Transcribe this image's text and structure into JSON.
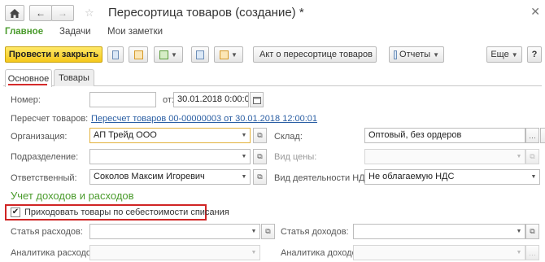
{
  "nav": {
    "home_icon": "home-icon",
    "back_icon": "arrow-left-icon",
    "forward_icon": "arrow-right-icon",
    "favorite_icon": "star-icon",
    "close_icon": "close-icon"
  },
  "window": {
    "title": "Пересортица товаров (создание) *"
  },
  "sections": [
    {
      "label": "Главное"
    },
    {
      "label": "Задачи"
    },
    {
      "label": "Мои заметки"
    }
  ],
  "toolbar": {
    "post_close": "Провести и закрыть",
    "act": "Акт о пересортице товаров",
    "reports": "Отчеты",
    "more": "Еще",
    "help": "?"
  },
  "tabs": [
    {
      "label": "Основное"
    },
    {
      "label": "Товары"
    }
  ],
  "form": {
    "number_label": "Номер:",
    "number_value": "",
    "date_prefix": "от:",
    "date_value": "30.01.2018  0:00:00",
    "regrade_label": "Пересчет товаров:",
    "regrade_link": "Пересчет товаров 00-00000003 от 30.01.2018 12:00:01",
    "org_label": "Организация:",
    "org_value": "АП Трейд ООО",
    "warehouse_label": "Склад:",
    "warehouse_value": "Оптовый, без ордеров",
    "division_label": "Подразделение:",
    "division_value": "",
    "price_type_label": "Вид цены:",
    "price_type_value": "",
    "responsible_label": "Ответственный:",
    "responsible_value": "Соколов Максим Игоревич",
    "vat_label": "Вид деятельности НДС:",
    "vat_value": "Не облагаемую НДС",
    "section_title": "Учет доходов и расходов",
    "checkbox_label": "Приходовать товары по себестоимости списания",
    "checkbox_checked": "✔",
    "expense_item_label": "Статья расходов:",
    "expense_item_value": "",
    "income_item_label": "Статья доходов:",
    "income_item_value": "",
    "expense_analytics_label": "Аналитика расходов:",
    "expense_analytics_value": "",
    "income_analytics_label": "Аналитика доходов:",
    "income_analytics_value": ""
  },
  "colors": {
    "accent_green": "#4a9b2c",
    "primary_button": "#f5c81c",
    "highlight_red": "#d02424",
    "link_blue": "#2a5ea3"
  }
}
